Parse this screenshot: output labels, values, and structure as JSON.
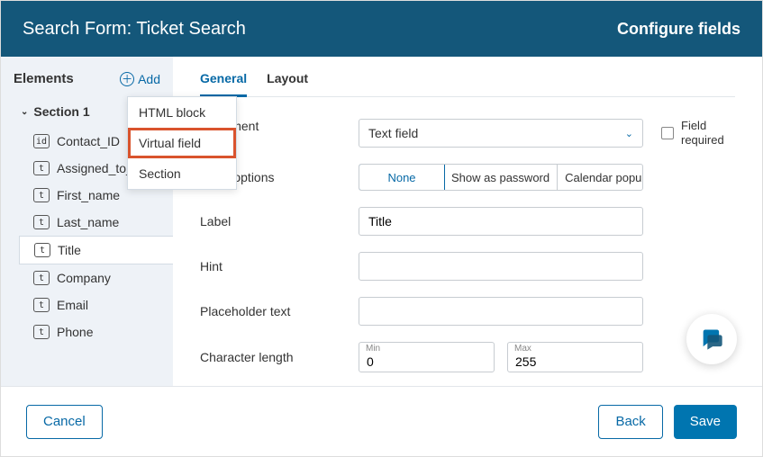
{
  "header": {
    "title": "Search Form: Ticket Search",
    "config_link": "Configure fields"
  },
  "sidebar": {
    "title": "Elements",
    "add_label": "Add",
    "section_label": "Section 1",
    "items": [
      {
        "badge": "id",
        "label": "Contact_ID",
        "selected": false
      },
      {
        "badge": "t",
        "label": "Assigned_to_I…",
        "selected": false
      },
      {
        "badge": "t",
        "label": "First_name",
        "selected": false
      },
      {
        "badge": "t",
        "label": "Last_name",
        "selected": false
      },
      {
        "badge": "t",
        "label": "Title",
        "selected": true
      },
      {
        "badge": "t",
        "label": "Company",
        "selected": false
      },
      {
        "badge": "t",
        "label": "Email",
        "selected": false
      },
      {
        "badge": "t",
        "label": "Phone",
        "selected": false
      }
    ]
  },
  "add_menu": {
    "items": [
      "HTML block",
      "Virtual field",
      "Section"
    ],
    "highlighted_index": 1
  },
  "tabs": {
    "items": [
      "General",
      "Layout"
    ],
    "active_index": 0
  },
  "form": {
    "form_element": {
      "label": "m element",
      "value": "Text field"
    },
    "field_required": {
      "label": "Field required",
      "checked": false
    },
    "text_field_options": {
      "label": "t field options",
      "options": [
        "None",
        "Show as password",
        "Calendar popup"
      ],
      "active_index": 0
    },
    "label_field": {
      "label": "Label",
      "value": "Title"
    },
    "hint": {
      "label": "Hint",
      "value": ""
    },
    "placeholder_text": {
      "label": "Placeholder text",
      "value": ""
    },
    "char_length": {
      "label": "Character length",
      "min_label": "Min",
      "min_value": "0",
      "max_label": "Max",
      "max_value": "255"
    }
  },
  "footer": {
    "cancel": "Cancel",
    "back": "Back",
    "save": "Save"
  }
}
